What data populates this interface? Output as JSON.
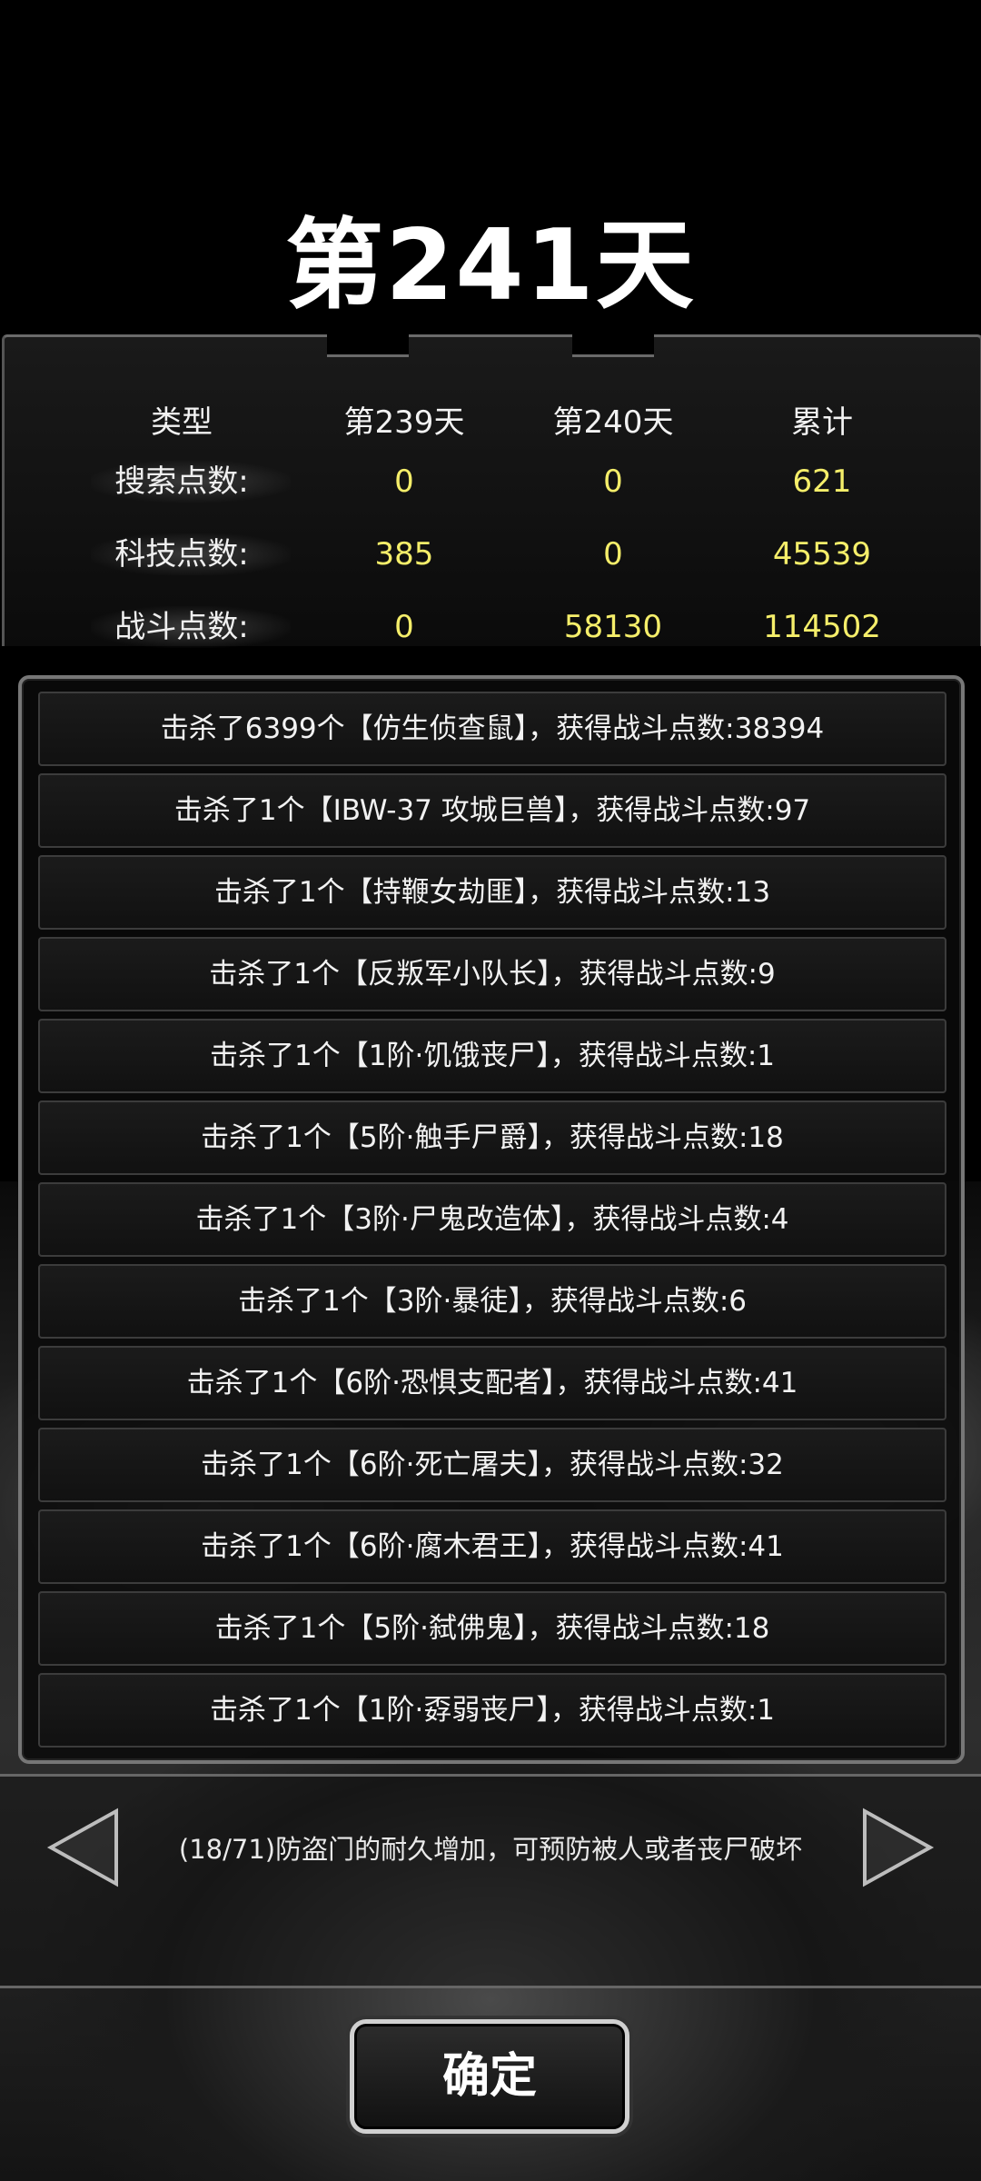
{
  "title": "第241天",
  "stats": {
    "headers": [
      "类型",
      "第239天",
      "第240天",
      "累计"
    ],
    "rows": [
      {
        "label": "搜索点数:",
        "day239": "0",
        "day240": "0",
        "total": "621"
      },
      {
        "label": "科技点数:",
        "day239": "385",
        "day240": "0",
        "total": "45539"
      },
      {
        "label": "战斗点数:",
        "day239": "0",
        "day240": "58130",
        "total": "114502"
      }
    ]
  },
  "kills": [
    "击杀了6399个【仿生侦查鼠】，获得战斗点数:38394",
    "击杀了1个【IBW-37 攻城巨兽】，获得战斗点数:97",
    "击杀了1个【持鞭女劫匪】，获得战斗点数:13",
    "击杀了1个【反叛军小队长】，获得战斗点数:9",
    "击杀了1个【1阶·饥饿丧尸】，获得战斗点数:1",
    "击杀了1个【5阶·触手尸爵】，获得战斗点数:18",
    "击杀了1个【3阶·尸鬼改造体】，获得战斗点数:4",
    "击杀了1个【3阶·暴徒】，获得战斗点数:6",
    "击杀了1个【6阶·恐惧支配者】，获得战斗点数:41",
    "击杀了1个【6阶·死亡屠夫】，获得战斗点数:32",
    "击杀了1个【6阶·腐木君王】，获得战斗点数:41",
    "击杀了1个【5阶·弑佛鬼】，获得战斗点数:18",
    "击杀了1个【1阶·孬弱丧尸】，获得战斗点数:1"
  ],
  "tip": "(18/71)防盗门的耐久增加，可预防被人或者丧尸破坏",
  "confirm_label": "确定",
  "icons": {
    "prev": "triangle-left-icon",
    "next": "triangle-right-icon"
  },
  "colors": {
    "value": "#f5ee6a",
    "text": "#f2f2f2",
    "background": "#000000"
  }
}
